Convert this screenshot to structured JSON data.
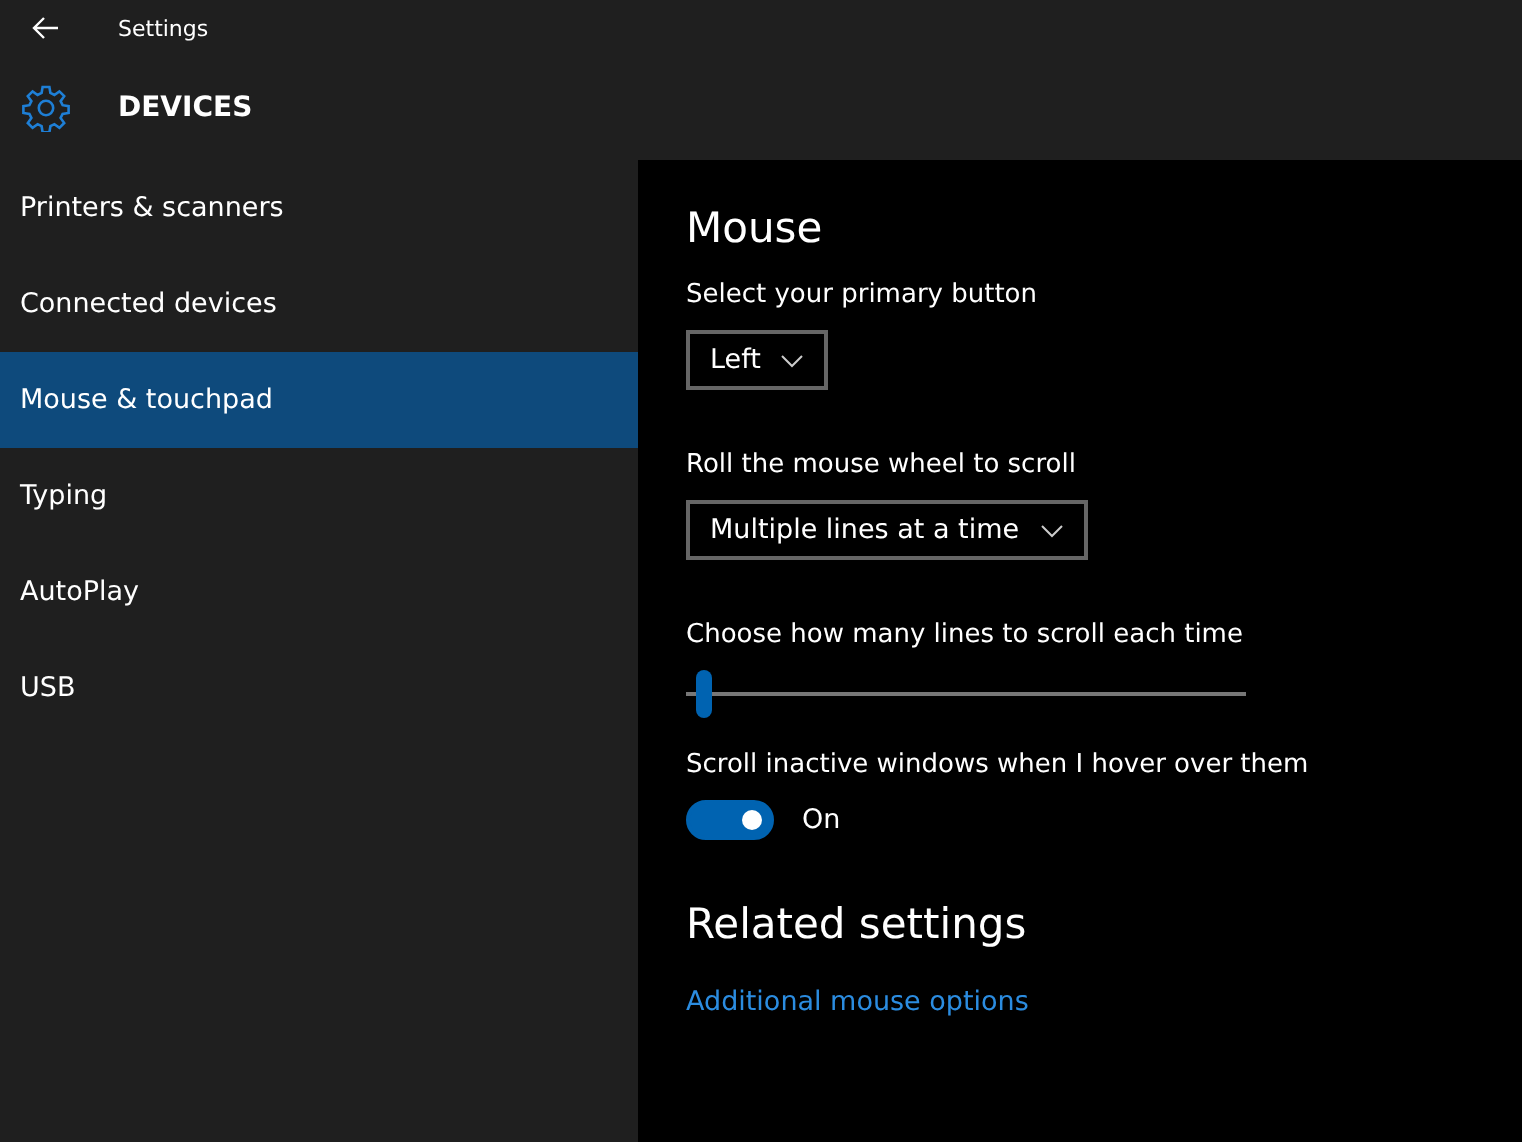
{
  "window": {
    "title": "Settings"
  },
  "header": {
    "title": "DEVICES"
  },
  "sidebar": {
    "items": [
      {
        "label": "Printers & scanners",
        "selected": false
      },
      {
        "label": "Connected devices",
        "selected": false
      },
      {
        "label": "Mouse & touchpad",
        "selected": true
      },
      {
        "label": "Typing",
        "selected": false
      },
      {
        "label": "AutoPlay",
        "selected": false
      },
      {
        "label": "USB",
        "selected": false
      }
    ]
  },
  "content": {
    "title": "Mouse",
    "settings": [
      {
        "kind": "dropdown",
        "label": "Select your primary button",
        "value": "Left"
      },
      {
        "kind": "dropdown",
        "label": "Roll the mouse wheel to scroll",
        "value": "Multiple lines at a time"
      },
      {
        "kind": "slider",
        "label": "Choose how many lines to scroll each time",
        "level": 0.02
      },
      {
        "kind": "toggle",
        "label": "Scroll inactive windows when I hover over them",
        "on": true,
        "state_label": "On"
      }
    ],
    "related": {
      "title": "Related settings",
      "links": [
        "Additional mouse options"
      ]
    }
  }
}
